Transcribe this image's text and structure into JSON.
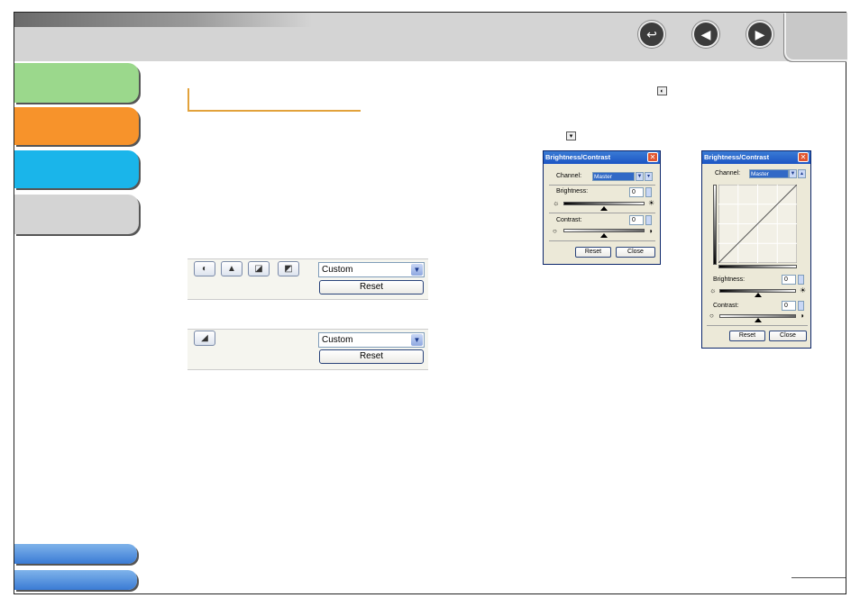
{
  "toolbar": {
    "back_icon": "return-arrow-icon",
    "prev_icon": "left-arrow-icon",
    "next_icon": "right-arrow-icon"
  },
  "sidebar": {
    "tabs": [
      {
        "color": "#9bd88c"
      },
      {
        "color": "#f7932b"
      },
      {
        "color": "#1ab5ea"
      },
      {
        "color": "#d4d4d4"
      }
    ]
  },
  "panel1": {
    "preset": "Custom",
    "reset_label": "Reset",
    "icons": [
      "brightness-contrast-icon",
      "histogram-icon",
      "tone-curve-icon",
      "final-review-icon"
    ]
  },
  "panel2": {
    "preset": "Custom",
    "reset_label": "Reset",
    "icons": [
      "tone-adjust-icon"
    ]
  },
  "dialog1": {
    "title": "Brightness/Contrast",
    "channel_label": "Channel:",
    "channel_value": "Master",
    "brightness_label": "Brightness:",
    "brightness_value": "0",
    "contrast_label": "Contrast:",
    "contrast_value": "0",
    "reset_label": "Reset",
    "close_label": "Close"
  },
  "dialog2": {
    "title": "Brightness/Contrast",
    "channel_label": "Channel:",
    "channel_value": "Master",
    "brightness_label": "Brightness:",
    "brightness_value": "0",
    "contrast_label": "Contrast:",
    "contrast_value": "0",
    "reset_label": "Reset",
    "close_label": "Close"
  },
  "colors": {
    "accent_orange": "#e2a23b",
    "title_blue": "#1c55c4"
  }
}
